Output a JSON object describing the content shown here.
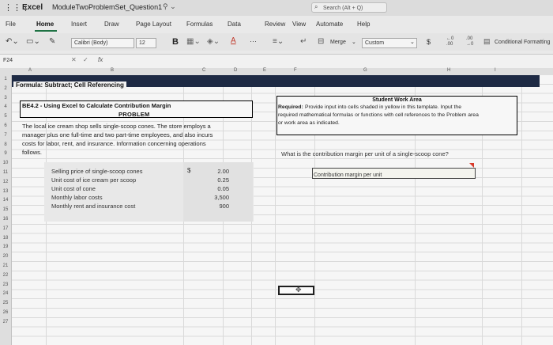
{
  "titlebar": {
    "app": "Excel",
    "doc": "ModuleTwoProblemSet_Question1",
    "search": "Search (Alt + Q)"
  },
  "tabs": [
    "File",
    "Home",
    "Insert",
    "Draw",
    "Page Layout",
    "Formulas",
    "Data",
    "Review",
    "View",
    "Automate",
    "Help"
  ],
  "ribbon": {
    "font_name": "Calibri (Body)",
    "font_size": "12",
    "bold": "B",
    "merge": "Merge",
    "number_format": "Custom",
    "currency": "$",
    "cond_format": "Conditional Formatting",
    "more": "···"
  },
  "formula_bar": {
    "cell_ref": "F24",
    "fx": "fx"
  },
  "columns": [
    "A",
    "B",
    "C",
    "D",
    "E",
    "F",
    "G",
    "H",
    "I"
  ],
  "rows": [
    "1",
    "2",
    "3",
    "4",
    "5",
    "6",
    "7",
    "8",
    "9",
    "10",
    "11",
    "12",
    "13",
    "14",
    "15",
    "16",
    "17",
    "18",
    "19",
    "20",
    "21",
    "22",
    "23",
    "24",
    "25",
    "26",
    "27"
  ],
  "sheet": {
    "banner_title": "Formula: Subtract; Cell Referencing",
    "problem_title": "BE4.2 - Using Excel to Calculate Contribution Margin",
    "problem_sub": "PROBLEM",
    "para": [
      "The local ice cream shop sells single-scoop cones. The store employs a",
      "manager plus one full-time and two part-time employees, and also incurs",
      "costs for labor, rent, and insurance. Information concerning operations",
      "follows."
    ],
    "inputs": [
      {
        "label": "Selling price of single-scoop cones",
        "value": "2.00"
      },
      {
        "label": "Unit cost of ice cream per scoop",
        "value": "0.25"
      },
      {
        "label": "Unit cost of cone",
        "value": "0.05"
      },
      {
        "label": "Monthly labor costs",
        "value": "3,500"
      },
      {
        "label": "Monthly rent and insurance cost",
        "value": "900"
      }
    ],
    "currency_symbol": "$",
    "swa_title": "Student Work Area",
    "swa_required": "Required:",
    "swa_lines": [
      " Provide input into cells shaded in yellow in this template. Input the",
      "required mathematical formulas or functions with cell references to the Problem area",
      "or work area as indicated."
    ],
    "question": "What is the contribution margin per unit of a single-scoop cone?",
    "answer_label": "Contribution margin per unit"
  }
}
